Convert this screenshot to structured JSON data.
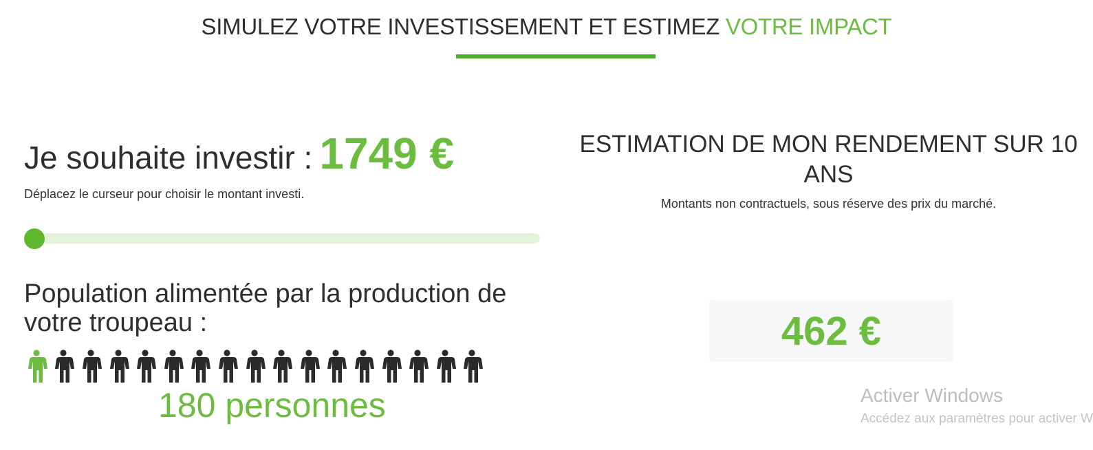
{
  "header": {
    "title_main": "SIMULEZ VOTRE INVESTISSEMENT ET ESTIMEZ",
    "title_accent": "VOTRE IMPACT",
    "accent_color": "#6cbd3f"
  },
  "invest": {
    "label": "Je souhaite investir :",
    "amount": "1749 €",
    "hint": "Déplacez le curseur pour choisir le montant investi.",
    "slider_fraction": 0
  },
  "population": {
    "title": "Population alimentée par la production de votre troupeau :",
    "icons_total": 17,
    "icons_highlighted": 1,
    "icon": "person-icon",
    "count_text": "180 personnes"
  },
  "estimate": {
    "title": "ESTIMATION DE MON RENDEMENT SUR 10 ANS",
    "note": "Montants non contractuels, sous réserve des prix du marché.",
    "value": "462 €"
  },
  "watermark": {
    "title": "Activer Windows",
    "subtitle": "Accédez aux paramètres pour activer Windows."
  }
}
